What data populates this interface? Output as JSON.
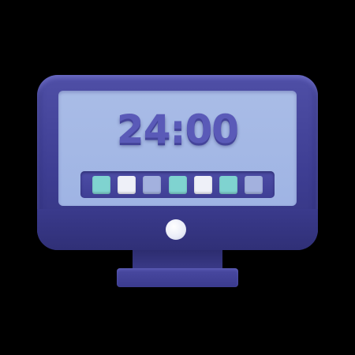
{
  "display": {
    "time": "24:00"
  },
  "slots": [
    {
      "color": "#7fd3d0"
    },
    {
      "color": "#eef0f8"
    },
    {
      "color": "#a3b1de"
    },
    {
      "color": "#7fd3d0"
    },
    {
      "color": "#eef0f8"
    },
    {
      "color": "#7fd3d0"
    },
    {
      "color": "#a3b1de"
    }
  ],
  "colors": {
    "monitor": "#3e3e93",
    "screen": "#a9bce6",
    "digits": "#5a5ab8",
    "power_button": "#ffffff"
  }
}
